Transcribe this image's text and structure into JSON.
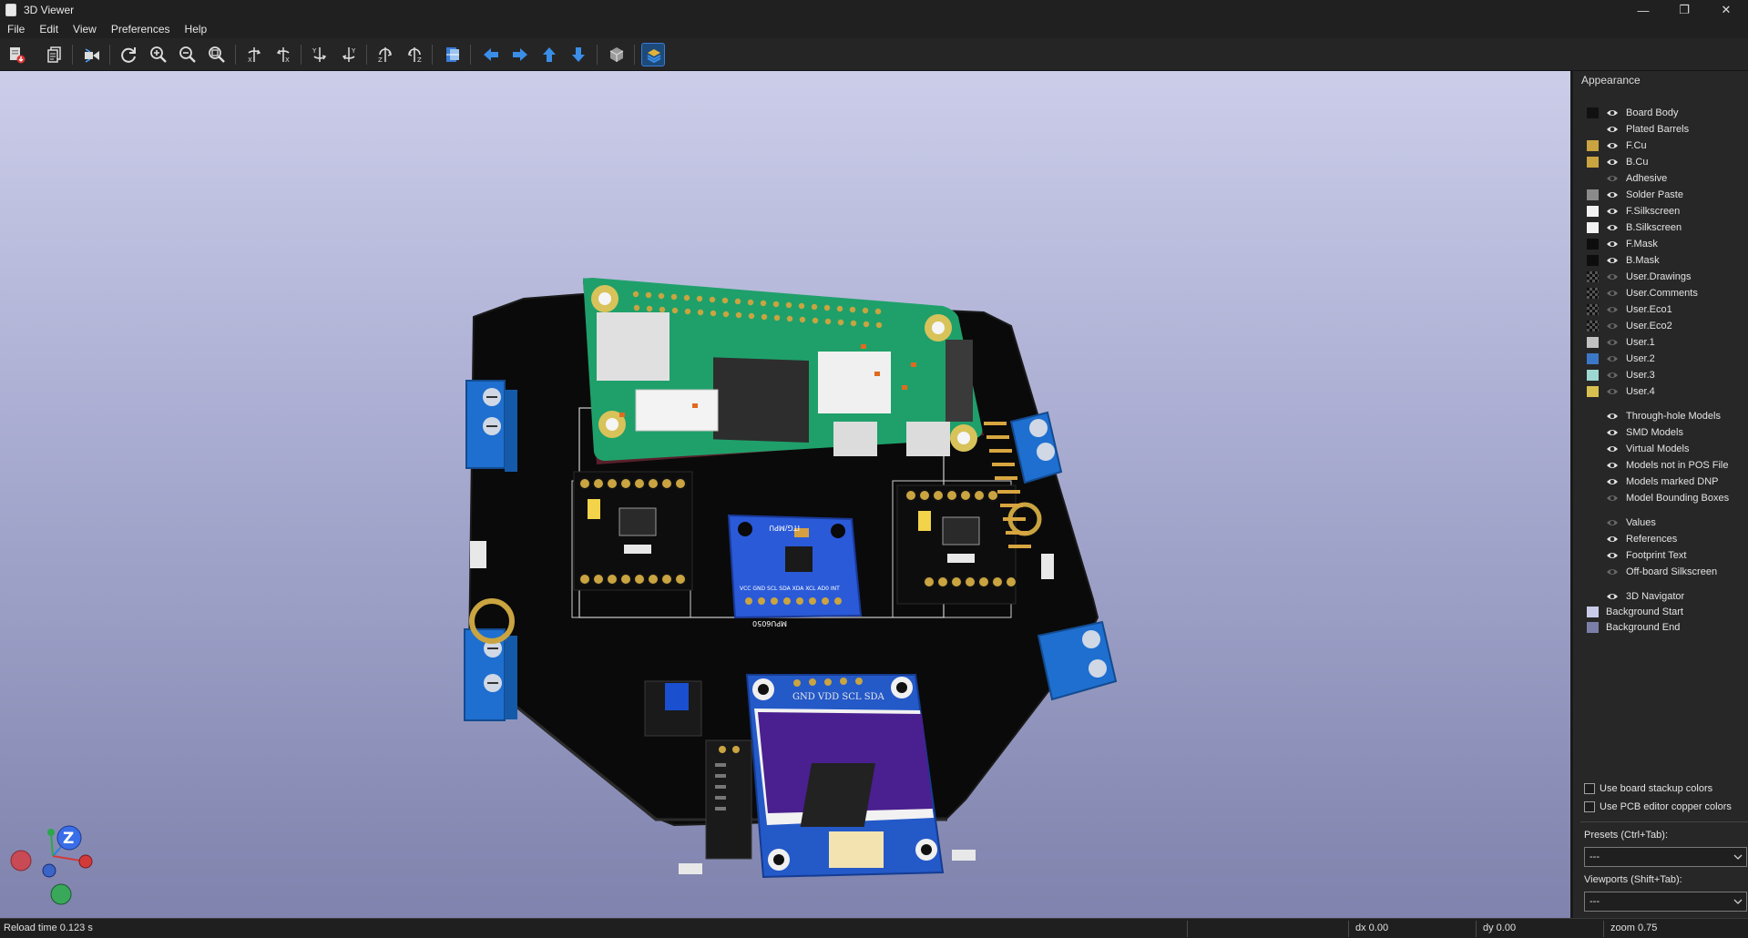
{
  "window": {
    "title": "3D Viewer"
  },
  "window_controls": {
    "minimize": "—",
    "restore": "❐",
    "close": "✕"
  },
  "menu": [
    "File",
    "Edit",
    "View",
    "Preferences",
    "Help"
  ],
  "toolbar_icons": [
    "export-image-icon",
    "copy-clipboard-icon",
    "raytrace-icon",
    "reload-icon",
    "zoom-in-icon",
    "zoom-out-icon",
    "zoom-fit-icon",
    "rotate-x-cw-icon",
    "rotate-x-ccw-icon",
    "rotate-y-cw-icon",
    "rotate-y-ccw-icon",
    "rotate-z-cw-icon",
    "rotate-z-ccw-icon",
    "flip-board-icon",
    "pan-left-icon",
    "pan-right-icon",
    "pan-up-icon",
    "pan-down-icon",
    "ortho-view-icon",
    "layers-manager-icon"
  ],
  "appearance": {
    "heading": "Appearance",
    "layers": [
      {
        "label": "Board Body",
        "swatch": "#111111",
        "visible": true
      },
      {
        "label": "Plated Barrels",
        "swatch": null,
        "visible": true
      },
      {
        "label": "F.Cu",
        "swatch": "#c9a440",
        "visible": true
      },
      {
        "label": "B.Cu",
        "swatch": "#c9a440",
        "visible": true
      },
      {
        "label": "Adhesive",
        "swatch": null,
        "visible": false
      },
      {
        "label": "Solder Paste",
        "swatch": "#8a8a8a",
        "visible": true
      },
      {
        "label": "F.Silkscreen",
        "swatch": "#f2f2f2",
        "visible": true
      },
      {
        "label": "B.Silkscreen",
        "swatch": "#f2f2f2",
        "visible": true
      },
      {
        "label": "F.Mask",
        "swatch": "#0d0d0d",
        "visible": true
      },
      {
        "label": "B.Mask",
        "swatch": "#0d0d0d",
        "visible": true
      },
      {
        "label": "User.Drawings",
        "swatch": "checker",
        "visible": false
      },
      {
        "label": "User.Comments",
        "swatch": "checker",
        "visible": false
      },
      {
        "label": "User.Eco1",
        "swatch": "checker",
        "visible": false
      },
      {
        "label": "User.Eco2",
        "swatch": "checker",
        "visible": false
      },
      {
        "label": "User.1",
        "swatch": "#c2c2c2",
        "visible": false
      },
      {
        "label": "User.2",
        "swatch": "#3c78c8",
        "visible": false
      },
      {
        "label": "User.3",
        "swatch": "#9ed8d2",
        "visible": false
      },
      {
        "label": "User.4",
        "swatch": "#d7c050",
        "visible": false
      }
    ],
    "models": [
      {
        "label": "Through-hole Models",
        "visible": true
      },
      {
        "label": "SMD Models",
        "visible": true
      },
      {
        "label": "Virtual Models",
        "visible": true
      },
      {
        "label": "Models not in POS File",
        "visible": true
      },
      {
        "label": "Models marked DNP",
        "visible": true
      },
      {
        "label": "Model Bounding Boxes",
        "visible": false
      }
    ],
    "texts": [
      {
        "label": "Values",
        "visible": false
      },
      {
        "label": "References",
        "visible": true
      },
      {
        "label": "Footprint Text",
        "visible": true
      },
      {
        "label": "Off-board Silkscreen",
        "visible": false
      }
    ],
    "misc": [
      {
        "label": "3D Navigator",
        "visible": true,
        "swatch": null
      },
      {
        "label": "Background Start",
        "visible": null,
        "swatch": "#c9cbe8"
      },
      {
        "label": "Background End",
        "visible": null,
        "swatch": "#7b7fa8"
      }
    ],
    "use_stackup_colors": "Use board stackup colors",
    "use_pcb_copper_colors": "Use PCB editor copper colors",
    "presets_label": "Presets (Ctrl+Tab):",
    "presets_value": "---",
    "viewports_label": "Viewports (Shift+Tab):",
    "viewports_value": "---"
  },
  "board_text": {
    "oled_header": "GND VDD SCL SDA",
    "mpu_label": "MPU6050",
    "mpu_pins": "VCC GND SCL SDA XDA XCL AD0 INT",
    "imu_brand": "ITG/MPU"
  },
  "axes": {
    "z": "Z"
  },
  "status": {
    "reload": "Reload time 0.123 s",
    "dx": "dx 0.00",
    "dy": "dy 0.00",
    "zoom": "zoom 0.75"
  }
}
